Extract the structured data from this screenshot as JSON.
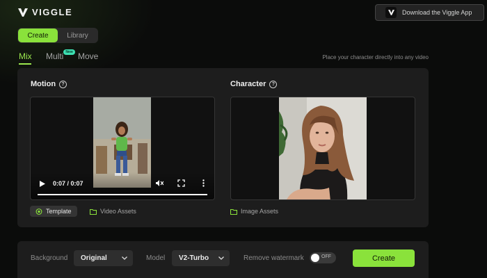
{
  "app": {
    "logo_text": "VIGGLE"
  },
  "header": {
    "download_label": "Download the Viggle App"
  },
  "main_toggle": {
    "create_label": "Create",
    "library_label": "Library",
    "active": "create"
  },
  "tabs": [
    {
      "label": "Mix",
      "active": true
    },
    {
      "label": "Multi",
      "active": false,
      "badge": "New"
    },
    {
      "label": "Move",
      "active": false
    }
  ],
  "hint_text": "Place your character directly into any video",
  "motion": {
    "title": "Motion",
    "help_icon": "question-circle-icon",
    "video": {
      "current_time": "0:07 / 0:07",
      "progress": 1.0
    },
    "template_label": "Template",
    "video_assets_label": "Video Assets"
  },
  "character": {
    "title": "Character",
    "help_icon": "question-circle-icon",
    "image_assets_label": "Image Assets"
  },
  "settings": {
    "background_label": "Background",
    "background_value": "Original",
    "model_label": "Model",
    "model_value": "V2-Turbo",
    "watermark_label": "Remove watermark",
    "watermark_toggle": "OFF",
    "create_label": "Create"
  },
  "colors": {
    "accent": "#8ae23b",
    "panel": "#1d1d1d",
    "background": "#0b0c0b",
    "badge": "#3de0b2"
  }
}
